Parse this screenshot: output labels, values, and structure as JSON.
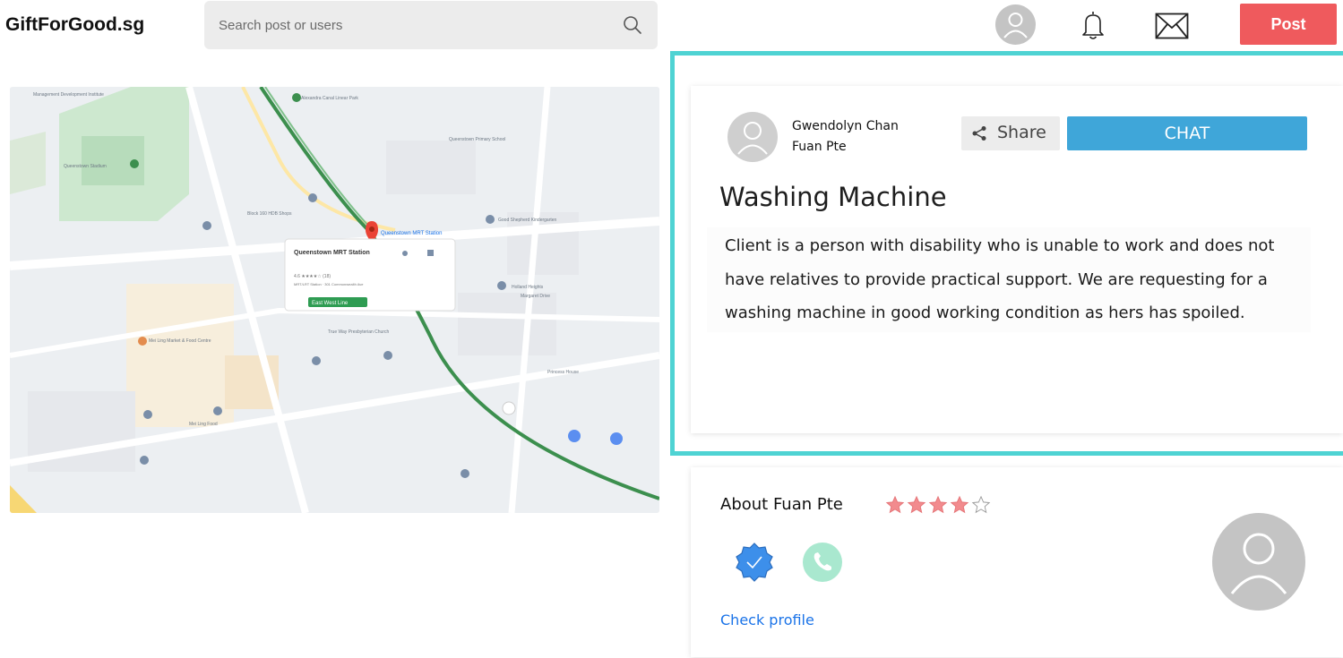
{
  "header": {
    "logo": "GiftForGood.sg",
    "search_placeholder": "Search post or users",
    "post_label": "Post"
  },
  "colors": {
    "accent_teal": "#4fd3d3",
    "post_red": "#ef5a5d",
    "chat_blue": "#3fa6d9",
    "star_pink": "#f28b8e",
    "link_blue": "#1a73e8"
  },
  "map": {
    "popup_title": "Queenstown MRT Station",
    "popup_rating": "4.6 ★★★★☆ (18)",
    "popup_sub": "MRT/LRT Station · 301 Commonwealth Ave",
    "popup_badge": "East West Line",
    "pin_label": "Queenstown MRT Station",
    "labels": [
      "Management Development Institute",
      "Queenstown Stadium",
      "Alexandra Canal Linear Park",
      "Queenstown Primary School",
      "Block 160 HDB Shops",
      "Good Shepherd Kindergarten",
      "Holland Heights",
      "True Way Presbyterian Church",
      "Mei Ling Market & Food Centre",
      "Princess House",
      "Mei Ling Food",
      "Margaret Drive"
    ]
  },
  "post": {
    "poster_name": "Gwendolyn Chan",
    "poster_org": "Fuan Pte",
    "share_label": "Share",
    "chat_label": "CHAT",
    "title": "Washing Machine",
    "description": "Client is a person with disability who is unable to work and does not have relatives to provide practical support. We are requesting for a washing machine in good working condition as hers has spoiled."
  },
  "about": {
    "title": "About Fuan Pte",
    "rating": 4,
    "rating_max": 5,
    "check_profile": "Check profile",
    "icons": [
      "verified-badge-icon",
      "phone-icon"
    ]
  }
}
